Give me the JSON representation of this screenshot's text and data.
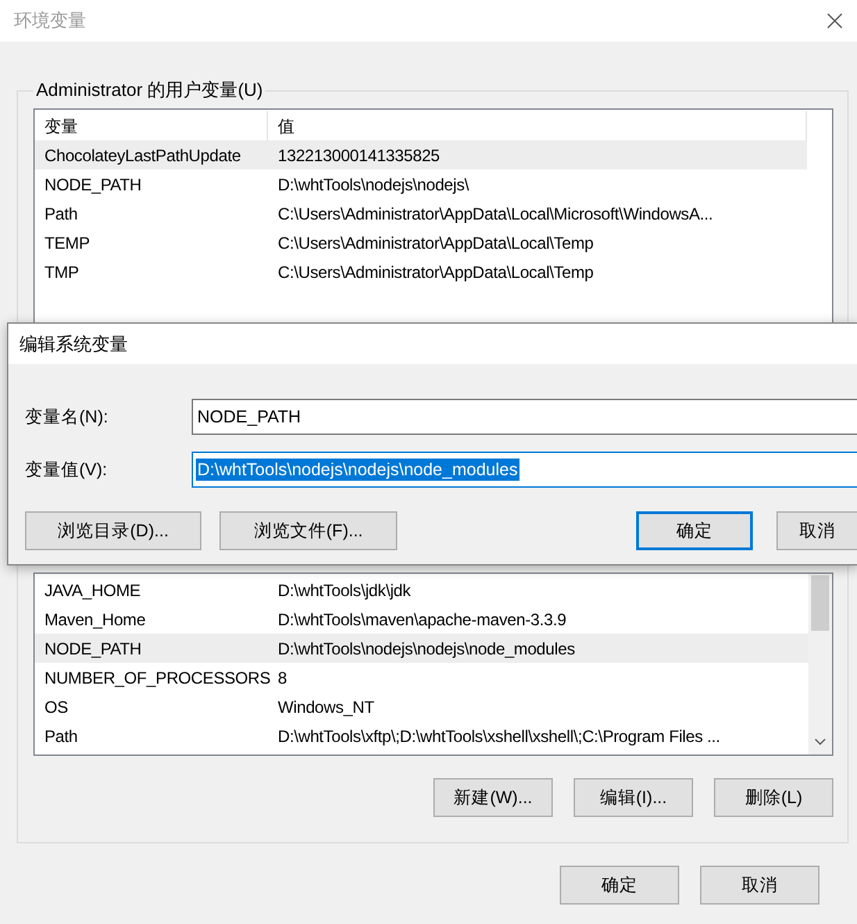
{
  "window": {
    "title": "环境变量"
  },
  "user_variables": {
    "label": "Administrator 的用户变量(U)",
    "columns": [
      "变量",
      "值"
    ],
    "rows": [
      {
        "name": "ChocolateyLastPathUpdate",
        "value": "132213000141335825",
        "selected": true
      },
      {
        "name": "NODE_PATH",
        "value": "D:\\whtTools\\nodejs\\nodejs\\",
        "selected": false
      },
      {
        "name": "Path",
        "value": "C:\\Users\\Administrator\\AppData\\Local\\Microsoft\\WindowsA...",
        "selected": false
      },
      {
        "name": "TEMP",
        "value": "C:\\Users\\Administrator\\AppData\\Local\\Temp",
        "selected": false
      },
      {
        "name": "TMP",
        "value": "C:\\Users\\Administrator\\AppData\\Local\\Temp",
        "selected": false
      }
    ]
  },
  "system_variables": {
    "rows": [
      {
        "name": "JAVA_HOME",
        "value": "D:\\whtTools\\jdk\\jdk",
        "selected": false
      },
      {
        "name": "Maven_Home",
        "value": "D:\\whtTools\\maven\\apache-maven-3.3.9",
        "selected": false
      },
      {
        "name": "NODE_PATH",
        "value": "D:\\whtTools\\nodejs\\nodejs\\node_modules",
        "selected": true
      },
      {
        "name": "NUMBER_OF_PROCESSORS",
        "value": "8",
        "selected": false
      },
      {
        "name": "OS",
        "value": "Windows_NT",
        "selected": false
      },
      {
        "name": "Path",
        "value": "D:\\whtTools\\xftp\\;D:\\whtTools\\xshell\\xshell\\;C:\\Program Files ...",
        "selected": false
      }
    ],
    "buttons": [
      "新建(W)...",
      "编辑(I)...",
      "删除(L)"
    ]
  },
  "buttons": [
    "确定",
    "取消"
  ],
  "edit_dialog": {
    "title": "编辑系统变量",
    "fields": [
      {
        "label": "变量名(N):",
        "value": "NODE_PATH",
        "selected": false
      },
      {
        "label": "变量值(V):",
        "value": "D:\\whtTools\\nodejs\\nodejs\\node_modules",
        "selected": true
      }
    ],
    "buttons": [
      {
        "label": "浏览目录(D)...",
        "default": false
      },
      {
        "label": "浏览文件(F)...",
        "default": false
      },
      {
        "label": "确定",
        "default": true
      },
      {
        "label": "取消",
        "default": false
      }
    ]
  }
}
